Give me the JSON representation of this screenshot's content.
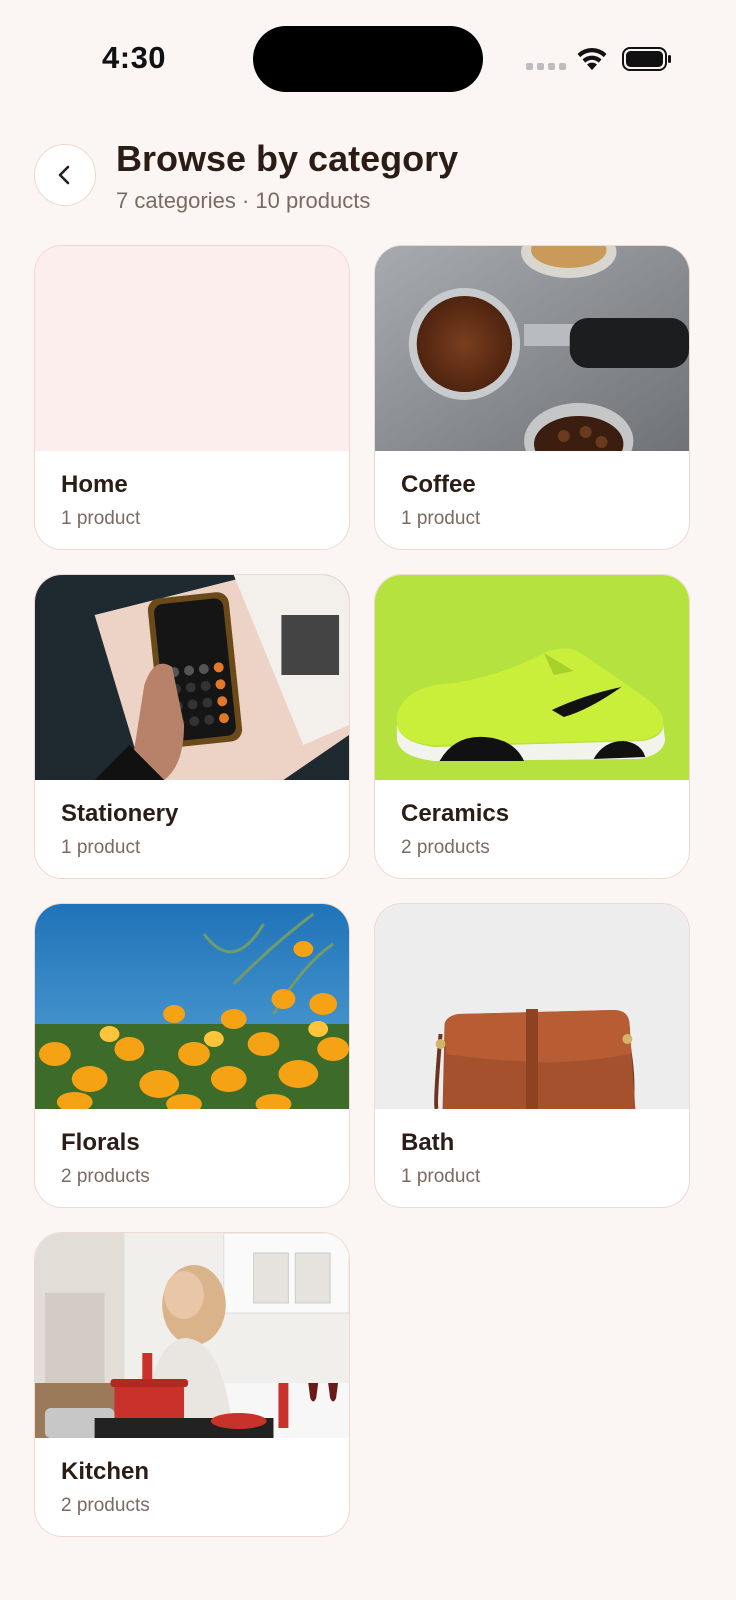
{
  "status_bar": {
    "time": "4:30"
  },
  "header": {
    "title": "Browse by category",
    "subtitle": "7 categories · 10 products"
  },
  "categories": [
    {
      "name": "Home",
      "count": "1 product",
      "image": "blank-pink-placeholder"
    },
    {
      "name": "Coffee",
      "count": "1 product",
      "image": "coffee-portafilter-photo"
    },
    {
      "name": "Stationery",
      "count": "1 product",
      "image": "calculator-phone-photo"
    },
    {
      "name": "Ceramics",
      "count": "2 products",
      "image": "green-sneaker-photo"
    },
    {
      "name": "Florals",
      "count": "2 products",
      "image": "orange-poppies-photo"
    },
    {
      "name": "Bath",
      "count": "1 product",
      "image": "brown-leather-bag-photo"
    },
    {
      "name": "Kitchen",
      "count": "2 products",
      "image": "woman-cooking-photo"
    }
  ],
  "colors": {
    "background": "#fbf6f3",
    "card_border": "#eed9d0",
    "title": "#2b1d16",
    "muted": "#7a6a62"
  }
}
